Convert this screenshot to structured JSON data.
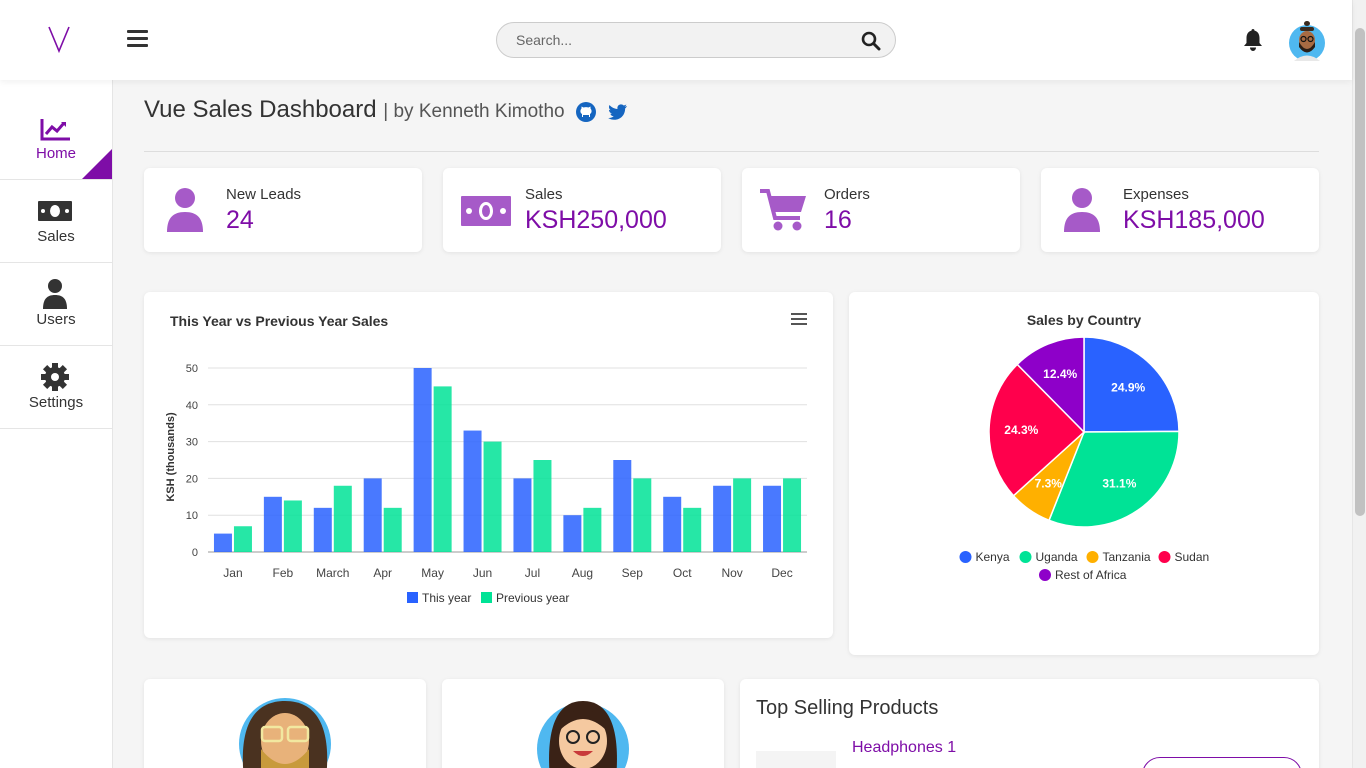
{
  "search": {
    "placeholder": "Search..."
  },
  "sidebar": {
    "items": [
      {
        "label": "Home",
        "icon": "chart-line-icon",
        "active": true
      },
      {
        "label": "Sales",
        "icon": "money-bill-icon"
      },
      {
        "label": "Users",
        "icon": "user-icon"
      },
      {
        "label": "Settings",
        "icon": "gear-icon"
      }
    ]
  },
  "page": {
    "title": "Vue Sales Dashboard",
    "subtitle": "| by Kenneth Kimotho"
  },
  "stats": [
    {
      "label": "New Leads",
      "value": "24",
      "icon": "user-icon"
    },
    {
      "label": "Sales",
      "value": "KSH250,000",
      "icon": "money-bill-icon"
    },
    {
      "label": "Orders",
      "value": "16",
      "icon": "cart-icon"
    },
    {
      "label": "Expenses",
      "value": "KSH185,000",
      "icon": "user-icon"
    }
  ],
  "colors": {
    "accent": "#7e0da7",
    "this_year": "#2962ff",
    "previous_year": "#00e396",
    "kenya": "#2962ff",
    "uganda": "#00e396",
    "tanzania": "#ffb000",
    "sudan": "#ff004c",
    "rest": "#8e00c9"
  },
  "chart_data": [
    {
      "type": "bar",
      "title": "This Year vs Previous Year Sales",
      "ylabel": "KSH (thousands)",
      "xlabel": "",
      "categories": [
        "Jan",
        "Feb",
        "March",
        "Apr",
        "May",
        "Jun",
        "Jul",
        "Aug",
        "Sep",
        "Oct",
        "Nov",
        "Dec"
      ],
      "series": [
        {
          "name": "This year",
          "values": [
            5,
            15,
            12,
            20,
            50,
            33,
            20,
            10,
            25,
            15,
            18,
            18
          ]
        },
        {
          "name": "Previous year",
          "values": [
            7,
            14,
            18,
            12,
            45,
            30,
            25,
            12,
            20,
            12,
            20,
            20
          ]
        }
      ],
      "ylim": [
        0,
        50
      ],
      "yticks": [
        0,
        10,
        20,
        30,
        40,
        50
      ],
      "grid": true,
      "legend": "bottom"
    },
    {
      "type": "pie",
      "title": "Sales by Country",
      "slices": [
        {
          "name": "Kenya",
          "value": 24.9,
          "label": "24.9%"
        },
        {
          "name": "Uganda",
          "value": 31.1,
          "label": "31.1%"
        },
        {
          "name": "Tanzania",
          "value": 7.3,
          "label": "7.3%"
        },
        {
          "name": "Sudan",
          "value": 24.3,
          "label": "24.3%"
        },
        {
          "name": "Rest of Africa",
          "value": 12.4,
          "label": "12.4%"
        }
      ],
      "legend": "bottom"
    }
  ],
  "top_products": {
    "title": "Top Selling Products",
    "items": [
      {
        "name": "Headphones 1"
      }
    ]
  }
}
